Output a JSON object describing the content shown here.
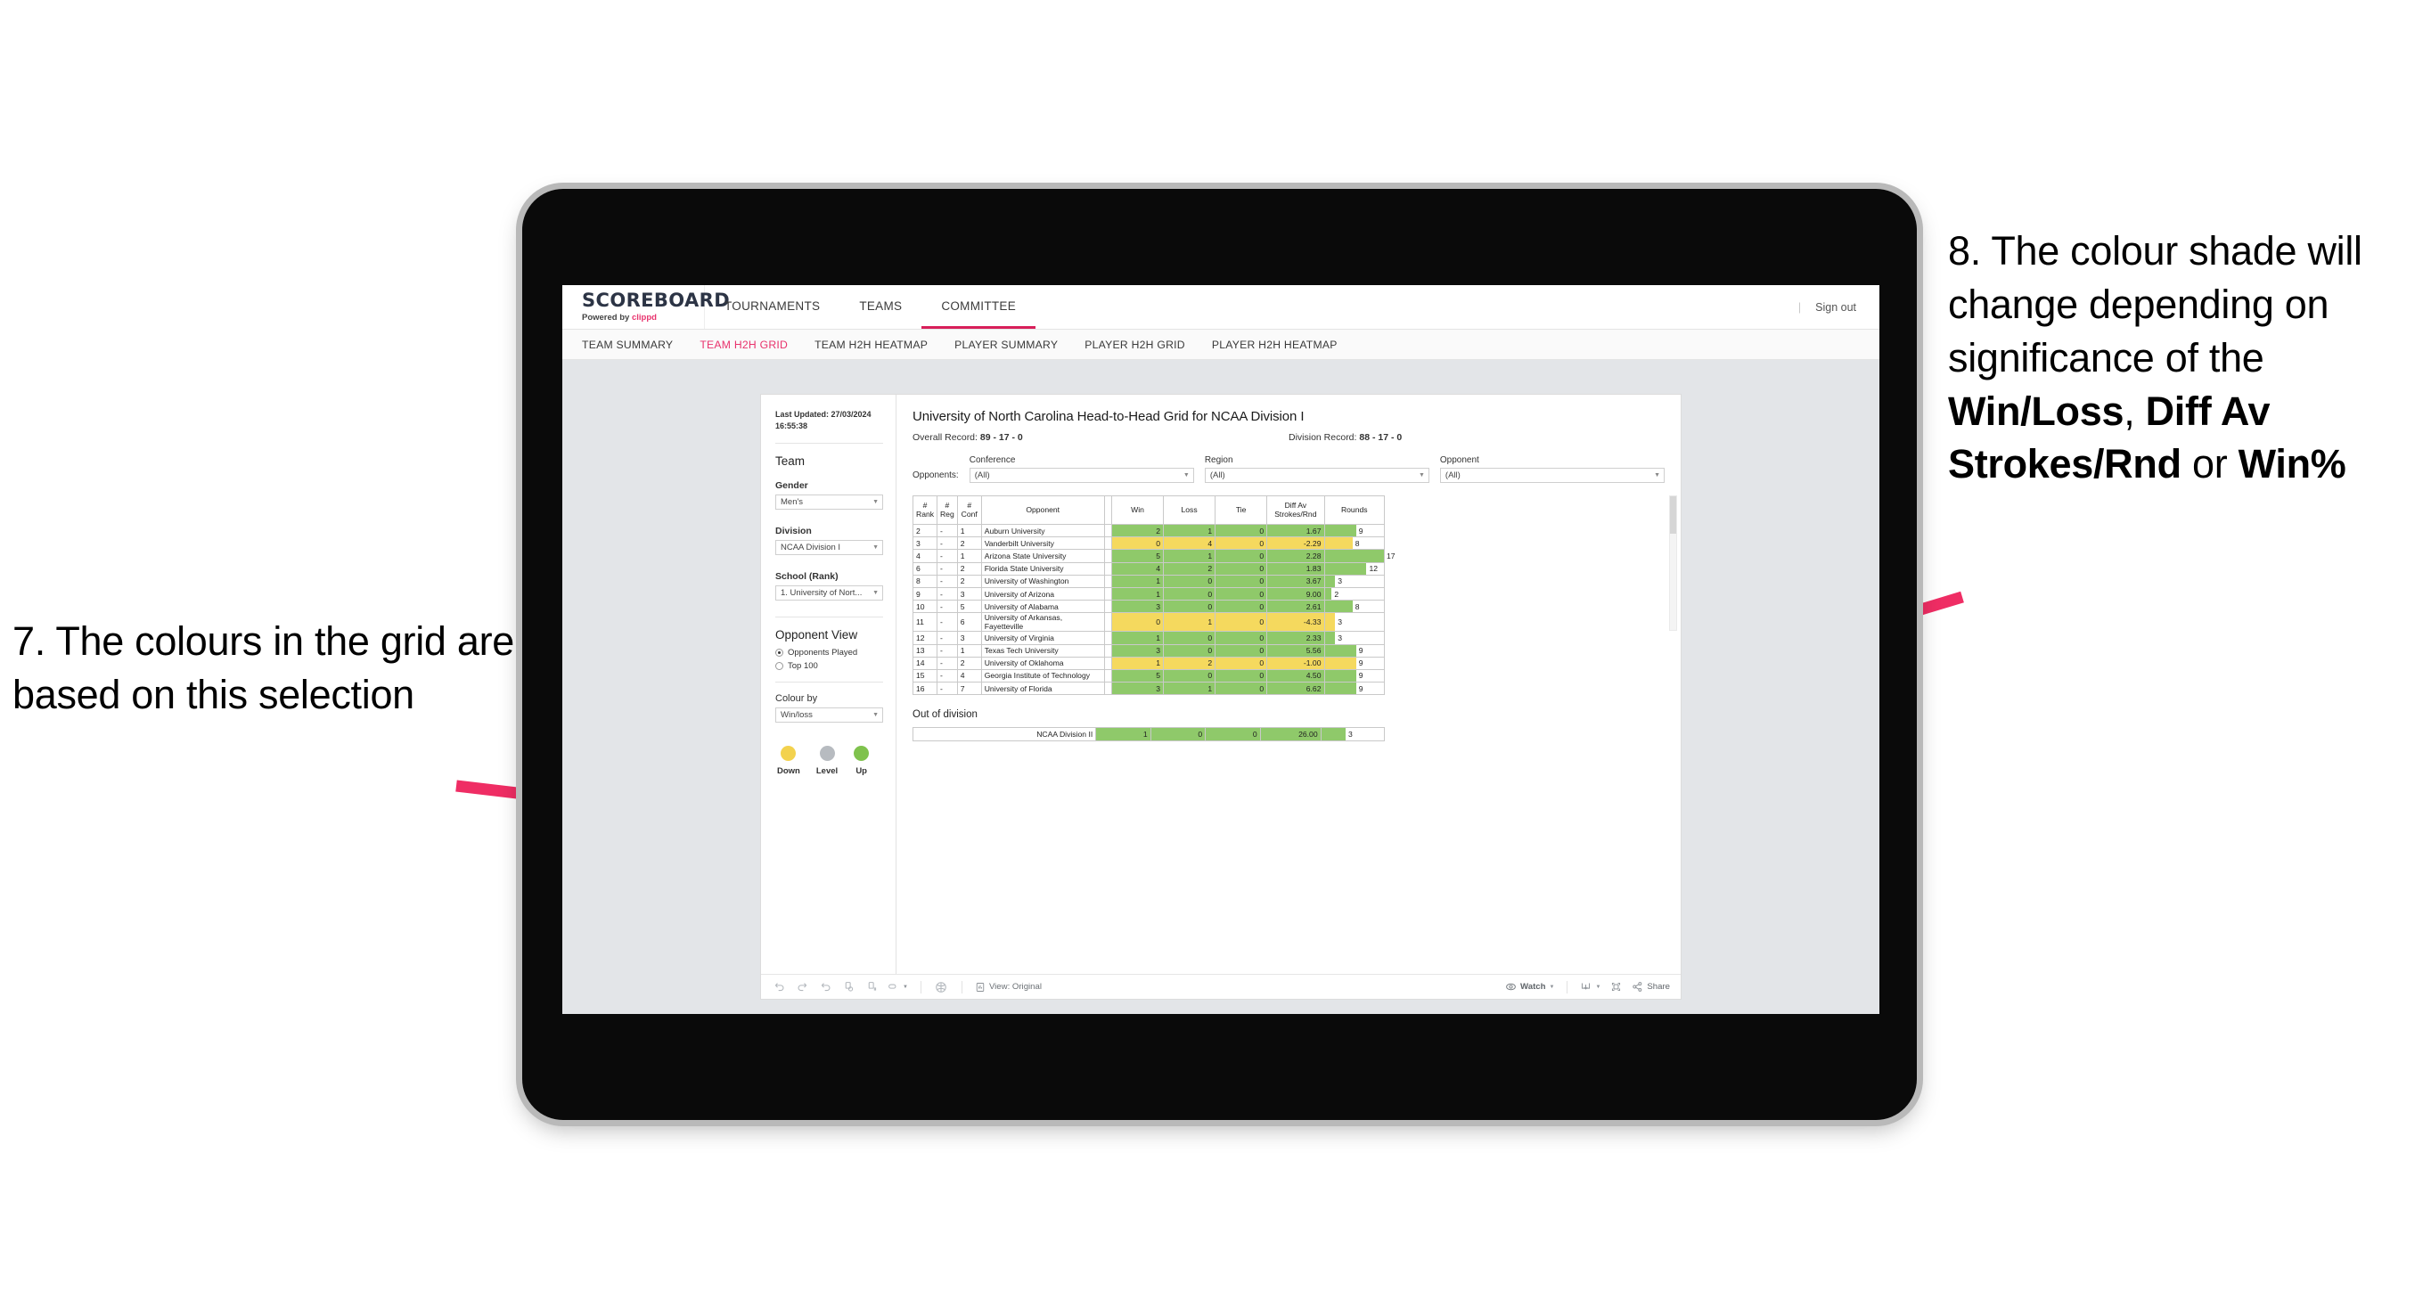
{
  "annotations": {
    "left": {
      "id": "7.",
      "text": "7. The colours in the grid are based on this selection"
    },
    "right": {
      "parts": [
        {
          "t": "8. The colour shade will change depending on significance of the ",
          "b": false
        },
        {
          "t": "Win/Loss",
          "b": true
        },
        {
          "t": ", ",
          "b": false
        },
        {
          "t": "Diff Av Strokes/Rnd",
          "b": true
        },
        {
          "t": " or ",
          "b": false
        },
        {
          "t": "Win%",
          "b": true
        }
      ],
      "arrow_color": "#ef2d64"
    }
  },
  "app": {
    "logo": {
      "word": "SCOREBOARD",
      "powered_prefix": "Powered by ",
      "brand": "clippd"
    },
    "topnav": [
      {
        "label": "TOURNAMENTS",
        "active": false
      },
      {
        "label": "TEAMS",
        "active": false
      },
      {
        "label": "COMMITTEE",
        "active": true
      }
    ],
    "sign_out": "Sign out",
    "separator": "|",
    "subnav": [
      {
        "label": "TEAM SUMMARY",
        "active": false
      },
      {
        "label": "TEAM H2H GRID",
        "active": true
      },
      {
        "label": "TEAM H2H HEATMAP",
        "active": false
      },
      {
        "label": "PLAYER SUMMARY",
        "active": false
      },
      {
        "label": "PLAYER H2H GRID",
        "active": false
      },
      {
        "label": "PLAYER H2H HEATMAP",
        "active": false
      }
    ]
  },
  "sidebar": {
    "last_updated": "Last Updated: 27/03/2024 16:55:38",
    "team_heading": "Team",
    "fields": [
      {
        "label": "Gender",
        "value": "Men's"
      },
      {
        "label": "Division",
        "value": "NCAA Division I"
      },
      {
        "label": "School (Rank)",
        "value": "1. University of Nort..."
      }
    ],
    "opponent_view": {
      "heading": "Opponent View",
      "options": [
        {
          "label": "Opponents Played",
          "selected": true
        },
        {
          "label": "Top 100",
          "selected": false
        }
      ]
    },
    "colour_by": {
      "label": "Colour by",
      "value": "Win/loss"
    },
    "legend": [
      {
        "caption": "Down",
        "color": "#f3d24e"
      },
      {
        "caption": "Level",
        "color": "#b7bbc0"
      },
      {
        "caption": "Up",
        "color": "#7fc24d"
      }
    ]
  },
  "main": {
    "title": "University of North Carolina Head-to-Head Grid for NCAA Division I",
    "records": [
      {
        "label": "Overall Record: ",
        "value": "89 - 17 - 0"
      },
      {
        "label": "Division Record: ",
        "value": "88 - 17 - 0"
      }
    ],
    "opponents_label": "Opponents:",
    "filters": [
      {
        "label": "Conference",
        "value": "(All)"
      },
      {
        "label": "Region",
        "value": "(All)"
      },
      {
        "label": "Opponent",
        "value": "(All)"
      }
    ],
    "out_of_division_title": "Out of division"
  },
  "chart_data": {
    "type": "table",
    "title": "University of North Carolina Head-to-Head Grid for NCAA Division I",
    "columns": [
      "# Rank",
      "# Reg",
      "# Conf",
      "Opponent",
      "Win",
      "Loss",
      "Tie",
      "Diff Av Strokes/Rnd",
      "Rounds"
    ],
    "colour_by": "Win/loss",
    "colours": {
      "up": "#8fc96a",
      "down": "#f5d95e",
      "level": "#b7bbc0",
      "bar": "#8fc96a"
    },
    "rounds_max": 17,
    "rows": [
      {
        "rank": "2",
        "reg": "-",
        "conf": "1",
        "opponent": "Auburn University",
        "win": "2",
        "loss": "1",
        "tie": "0",
        "diff": "1.67",
        "rounds": "9",
        "rounds_val": 9,
        "state": "up"
      },
      {
        "rank": "3",
        "reg": "-",
        "conf": "2",
        "opponent": "Vanderbilt University",
        "win": "0",
        "loss": "4",
        "tie": "0",
        "diff": "-2.29",
        "rounds": "8",
        "rounds_val": 8,
        "state": "down"
      },
      {
        "rank": "4",
        "reg": "-",
        "conf": "1",
        "opponent": "Arizona State University",
        "win": "5",
        "loss": "1",
        "tie": "0",
        "diff": "2.28",
        "rounds": "17",
        "rounds_val": 17,
        "state": "up"
      },
      {
        "rank": "6",
        "reg": "-",
        "conf": "2",
        "opponent": "Florida State University",
        "win": "4",
        "loss": "2",
        "tie": "0",
        "diff": "1.83",
        "rounds": "12",
        "rounds_val": 12,
        "state": "up"
      },
      {
        "rank": "8",
        "reg": "-",
        "conf": "2",
        "opponent": "University of Washington",
        "win": "1",
        "loss": "0",
        "tie": "0",
        "diff": "3.67",
        "rounds": "3",
        "rounds_val": 3,
        "state": "up"
      },
      {
        "rank": "9",
        "reg": "-",
        "conf": "3",
        "opponent": "University of Arizona",
        "win": "1",
        "loss": "0",
        "tie": "0",
        "diff": "9.00",
        "rounds": "2",
        "rounds_val": 2,
        "state": "up"
      },
      {
        "rank": "10",
        "reg": "-",
        "conf": "5",
        "opponent": "University of Alabama",
        "win": "3",
        "loss": "0",
        "tie": "0",
        "diff": "2.61",
        "rounds": "8",
        "rounds_val": 8,
        "state": "up"
      },
      {
        "rank": "11",
        "reg": "-",
        "conf": "6",
        "opponent": "University of Arkansas, Fayetteville",
        "win": "0",
        "loss": "1",
        "tie": "0",
        "diff": "-4.33",
        "rounds": "3",
        "rounds_val": 3,
        "state": "down"
      },
      {
        "rank": "12",
        "reg": "-",
        "conf": "3",
        "opponent": "University of Virginia",
        "win": "1",
        "loss": "0",
        "tie": "0",
        "diff": "2.33",
        "rounds": "3",
        "rounds_val": 3,
        "state": "up"
      },
      {
        "rank": "13",
        "reg": "-",
        "conf": "1",
        "opponent": "Texas Tech University",
        "win": "3",
        "loss": "0",
        "tie": "0",
        "diff": "5.56",
        "rounds": "9",
        "rounds_val": 9,
        "state": "up"
      },
      {
        "rank": "14",
        "reg": "-",
        "conf": "2",
        "opponent": "University of Oklahoma",
        "win": "1",
        "loss": "2",
        "tie": "0",
        "diff": "-1.00",
        "rounds": "9",
        "rounds_val": 9,
        "state": "down"
      },
      {
        "rank": "15",
        "reg": "-",
        "conf": "4",
        "opponent": "Georgia Institute of Technology",
        "win": "5",
        "loss": "0",
        "tie": "0",
        "diff": "4.50",
        "rounds": "9",
        "rounds_val": 9,
        "state": "up"
      },
      {
        "rank": "16",
        "reg": "-",
        "conf": "7",
        "opponent": "University of Florida",
        "win": "3",
        "loss": "1",
        "tie": "0",
        "diff": "6.62",
        "rounds": "9",
        "rounds_val": 9,
        "state": "up"
      }
    ],
    "out_of_division": [
      {
        "label": "NCAA Division II",
        "win": "1",
        "loss": "0",
        "tie": "0",
        "diff": "26.00",
        "rounds": "3",
        "rounds_val": 3,
        "state": "up"
      }
    ]
  },
  "toolbar": {
    "left_icons": [
      "undo-icon",
      "redo-icon",
      "revert-icon",
      "refresh-icon",
      "pause-icon",
      "custom-view-icon"
    ],
    "view_label": "View: Original",
    "watch_label": "Watch",
    "share_label": "Share",
    "right_icons": [
      "download-icon",
      "fullscreen-icon"
    ]
  }
}
